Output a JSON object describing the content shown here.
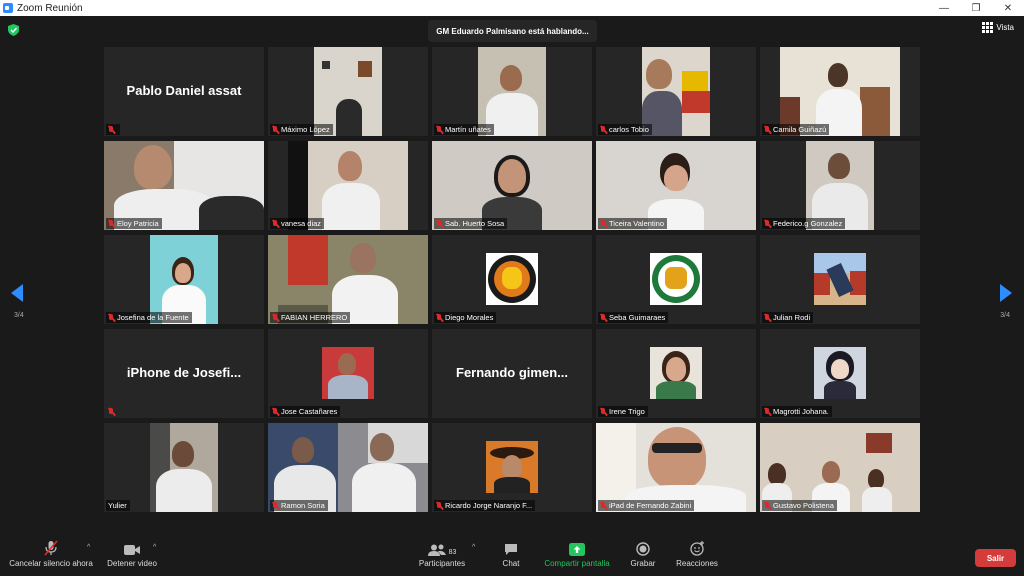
{
  "window": {
    "title": "Zoom Reunión",
    "minimize": "—",
    "restore": "❐",
    "close": "✕"
  },
  "header": {
    "speaker_text": "GM Eduardo Palmisano está hablando...",
    "view_label": "Vista"
  },
  "pager": {
    "left": "3/4",
    "right": "3/4"
  },
  "tiles": [
    {
      "name": "Pablo Daniel assat",
      "big": "Pablo Daniel assat",
      "muted": true
    },
    {
      "name": "Máximo López",
      "muted": true
    },
    {
      "name": "Martín uñates",
      "muted": true
    },
    {
      "name": "carlos Tobio",
      "muted": true
    },
    {
      "name": "Camila Guiñazú",
      "muted": true
    },
    {
      "name": "Eloy Patricia",
      "muted": true
    },
    {
      "name": "vanesa diaz",
      "muted": true
    },
    {
      "name": "Sab. Huerto Sosa",
      "muted": true
    },
    {
      "name": "Ticeira Valentino",
      "muted": true
    },
    {
      "name": "Federico.g Gonzalez",
      "muted": true
    },
    {
      "name": "Josefina de la Fuente",
      "muted": true
    },
    {
      "name": "FABIAN HERRERO",
      "muted": true
    },
    {
      "name": "Diego Morales",
      "muted": true
    },
    {
      "name": "Seba Guimaraes",
      "muted": true
    },
    {
      "name": "Julian Rodi",
      "muted": true
    },
    {
      "name": "",
      "big": "iPhone de Josefi...",
      "muted": true
    },
    {
      "name": "Jose Castañares",
      "muted": true
    },
    {
      "name": "",
      "big": "Fernando gimen...",
      "muted": false
    },
    {
      "name": "Irene Trigo",
      "muted": true
    },
    {
      "name": "Magrotti Johana.",
      "muted": true
    },
    {
      "name": "Yulier",
      "muted": false
    },
    {
      "name": "Ramon Soria",
      "muted": true
    },
    {
      "name": "Ricardo Jorge Naranjo F...",
      "muted": true
    },
    {
      "name": "iPad de Fernando Zabini",
      "muted": true
    },
    {
      "name": "Gustavo Polistena",
      "muted": true
    }
  ],
  "toolbar": {
    "unmute_label": "Cancelar silencio ahora",
    "video_label": "Detener video",
    "participants_label": "Participantes",
    "participants_count": "83",
    "chat_label": "Chat",
    "share_label": "Compartir pantalla",
    "record_label": "Grabar",
    "reactions_label": "Reacciones",
    "leave_label": "Salir",
    "caret": "^"
  },
  "colors": {
    "accent": "#2d8cff",
    "share_green": "#22c55e",
    "leave_red": "#d43b3b",
    "muted_red": "#e02828"
  }
}
